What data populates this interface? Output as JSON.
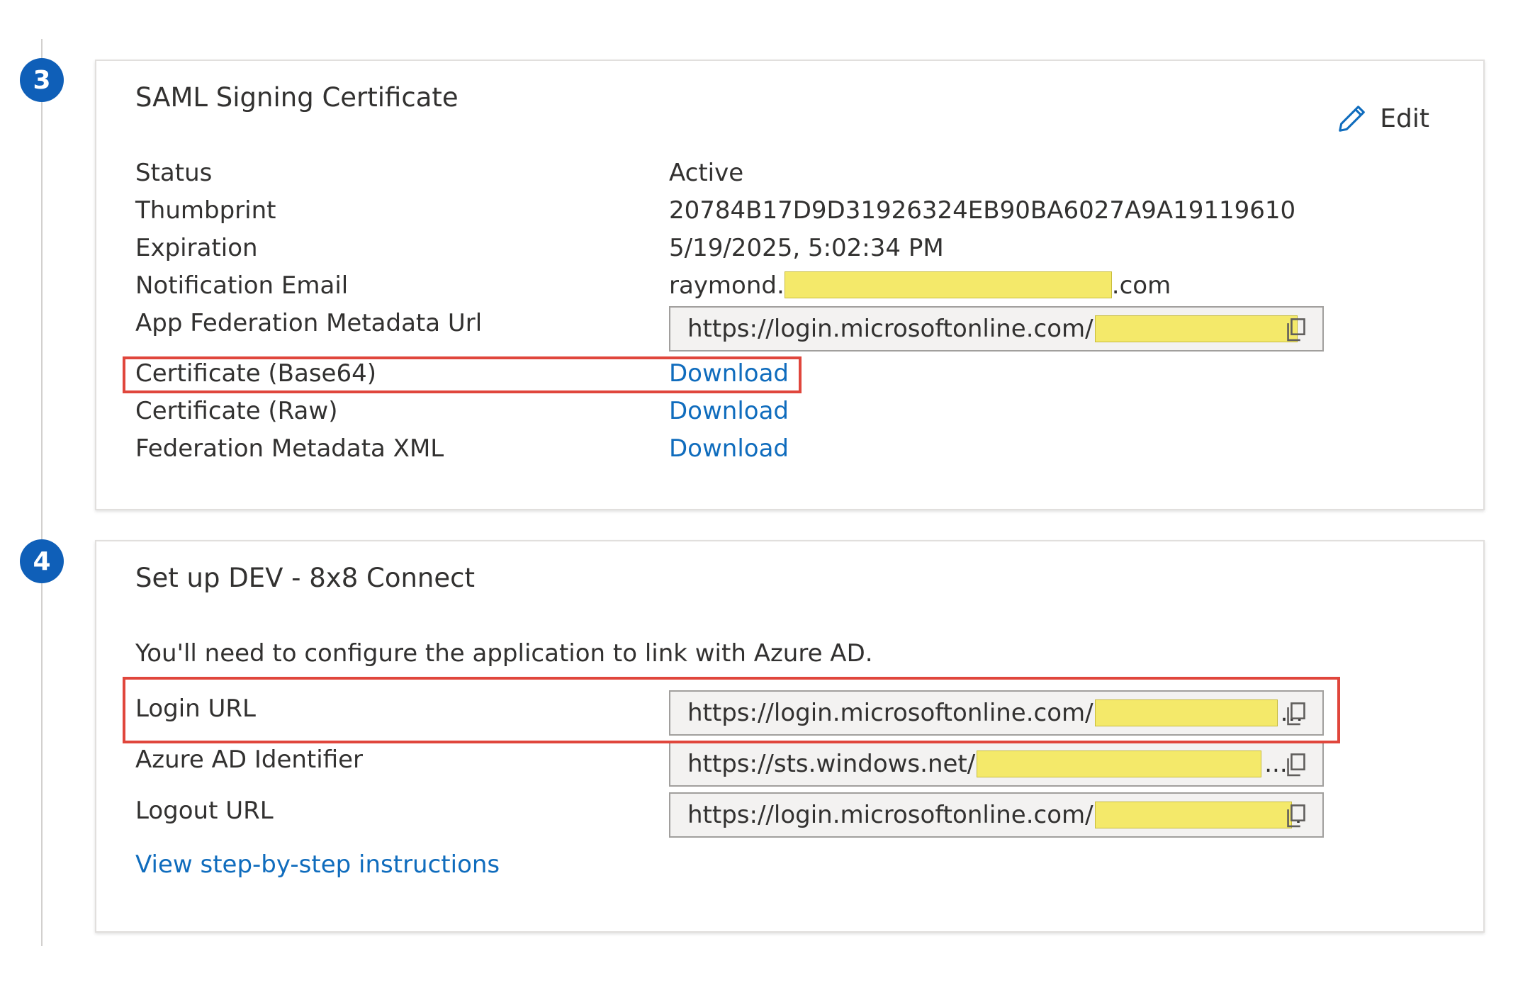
{
  "steps": [
    {
      "number": "3"
    },
    {
      "number": "4"
    }
  ],
  "saml": {
    "title": "SAML Signing Certificate",
    "edit_label": "Edit",
    "rows": {
      "status": {
        "label": "Status",
        "value": "Active"
      },
      "thumbprint": {
        "label": "Thumbprint",
        "value": "20784B17D9D31926324EB90BA6027A9A19119610"
      },
      "expiration": {
        "label": "Expiration",
        "value": "5/19/2025, 5:02:34 PM"
      },
      "notification_email": {
        "label": "Notification Email",
        "value_prefix": "raymond.",
        "value_suffix": ".com"
      },
      "metadata_url": {
        "label": "App Federation Metadata Url",
        "value_prefix": "https://login.microsoftonline.com/"
      },
      "cert_base64": {
        "label": "Certificate (Base64)",
        "link": "Download"
      },
      "cert_raw": {
        "label": "Certificate (Raw)",
        "link": "Download"
      },
      "federation_xml": {
        "label": "Federation Metadata XML",
        "link": "Download"
      }
    }
  },
  "setup": {
    "title": "Set up DEV - 8x8 Connect",
    "description": "You'll need to configure the application to link with Azure AD.",
    "rows": {
      "login_url": {
        "label": "Login URL",
        "value_prefix": "https://login.microsoftonline.com/",
        "ellipsis": "..."
      },
      "azure_ad_identifier": {
        "label": "Azure AD Identifier",
        "value_prefix": "https://sts.windows.net/",
        "ellipsis": "..."
      },
      "logout_url": {
        "label": "Logout URL",
        "value_prefix": "https://login.microsoftonline.com/",
        "ellipsis": "."
      }
    },
    "instructions_link": "View step-by-step instructions"
  },
  "colors": {
    "accent": "#0f6cbd",
    "badge": "#0f5fb8",
    "highlight": "#e0463c",
    "redaction": "#f4e96a"
  }
}
